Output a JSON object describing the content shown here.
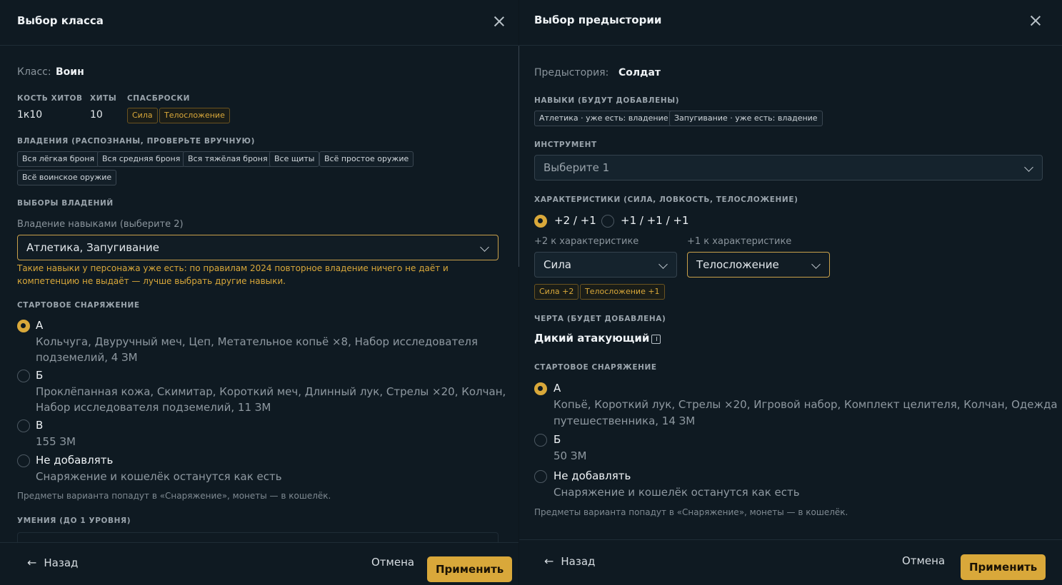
{
  "left": {
    "title": "Выбор класса",
    "class_label": "Класс:",
    "class_value": "Воин",
    "hit_die_label": "КОСТЬ ХИТОВ",
    "hit_die_value": "1к10",
    "hp_label": "ХИТЫ",
    "hp_value": "10",
    "saves_label": "СПАСБРОСКИ",
    "saves": [
      "Сила",
      "Телосложение"
    ],
    "proficiencies_label": "ВЛАДЕНИЯ (РАСПОЗНАНЫ, ПРОВЕРЬТЕ ВРУЧНУЮ)",
    "proficiencies": [
      "Вся лёгкая броня",
      "Вся средняя броня",
      "Вся тяжёлая броня",
      "Все щиты",
      "Всё простое оружие",
      "Всё воинское оружие"
    ],
    "choices_label": "ВЫБОРЫ ВЛАДЕНИЙ",
    "skills_field_label": "Владение навыками (выберите 2)",
    "skills_value": "Атлетика, Запугивание",
    "warning": [
      "Такие навыки у персонажа уже есть: по правилам 2024 повторное владение ничего не даёт и",
      "компетенцию не выдаёт — лучше выбрать другие навыки."
    ],
    "equipment_label": "СТАРТОВОЕ СНАРЯЖЕНИЕ",
    "equipment_options": [
      {
        "title": "А",
        "desc": [
          "Кольчуга, Двуручный меч, Цеп, Метательное копьё ×8, Набор исследователя",
          "подземелий, 4 ЗМ"
        ],
        "selected": true
      },
      {
        "title": "Б",
        "desc": [
          "Проклёпанная кожа, Скимитар, Короткий меч, Длинный лук, Стрелы ×20, Колчан,",
          "Набор исследователя подземелий, 11 ЗМ"
        ],
        "selected": false
      },
      {
        "title": "В",
        "desc": [
          "155 ЗМ"
        ],
        "selected": false
      },
      {
        "title": "Не добавлять",
        "desc": [
          "Снаряжение и кошелёк останутся как есть"
        ],
        "selected": false
      }
    ],
    "equipment_note": "Предметы варианта попадут в «Снаряжение», монеты — в кошелёк.",
    "skills_section_label": "УМЕНИЯ (ДО 1 УРОВНЯ)",
    "back_label": "Назад",
    "cancel_label": "Отмена",
    "apply_label": "Применить"
  },
  "right": {
    "title": "Выбор предыстории",
    "bg_label": "Предыстория:",
    "bg_value": "Солдат",
    "skills_label": "НАВЫКИ (БУДУТ ДОБАВЛЕНЫ)",
    "skills": [
      "Атлетика · уже есть: владение",
      "Запугивание · уже есть: владение"
    ],
    "tool_label": "ИНСТРУМЕНТ",
    "tool_placeholder": "Выберите 1",
    "abilities_label": "ХАРАКТЕРИСТИКИ (СИЛА, ЛОВКОСТЬ, ТЕЛОСЛОЖЕНИЕ)",
    "ability_modes": [
      {
        "label": "+2 / +1",
        "selected": true
      },
      {
        "label": "+1 / +1 / +1",
        "selected": false
      }
    ],
    "plus2_label": "+2 к характеристике",
    "plus2_value": "Сила",
    "plus1_label": "+1 к характеристике",
    "plus1_value": "Телосложение",
    "bonus_chips": [
      "Сила +2",
      "Телосложение +1"
    ],
    "feat_label": "ЧЕРТА (БУДЕТ ДОБАВЛЕНА)",
    "feat_value": "Дикий атакующий",
    "equipment_label": "СТАРТОВОЕ СНАРЯЖЕНИЕ",
    "equipment_options": [
      {
        "title": "А",
        "desc": [
          "Копьё, Короткий лук, Стрелы ×20, Игровой набор, Комплект целителя, Колчан, Одежда",
          "путешественника, 14 ЗМ"
        ],
        "selected": true
      },
      {
        "title": "Б",
        "desc": [
          "50 ЗМ"
        ],
        "selected": false
      },
      {
        "title": "Не добавлять",
        "desc": [
          "Снаряжение и кошелёк останутся как есть"
        ],
        "selected": false
      }
    ],
    "equipment_note": "Предметы варианта попадут в «Снаряжение», монеты — в кошелёк.",
    "back_label": "Назад",
    "cancel_label": "Отмена",
    "apply_label": "Применить"
  },
  "colors": {
    "accent": "#d9a83a",
    "background": "#0f1a22"
  }
}
